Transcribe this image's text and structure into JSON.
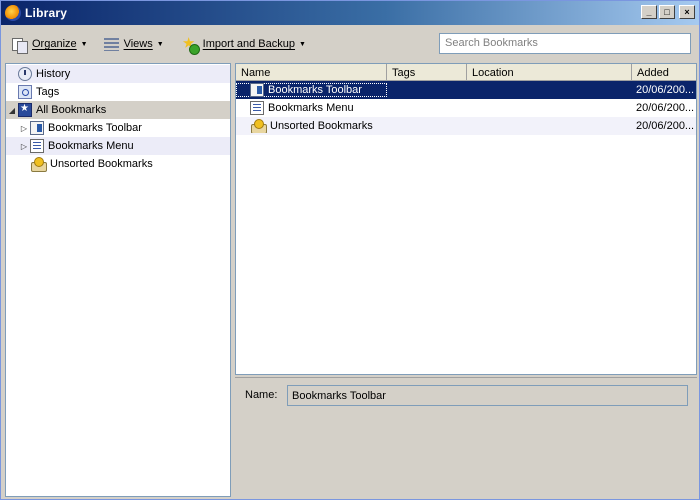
{
  "window": {
    "title": "Library",
    "controls": {
      "minimize": "_",
      "maximize": "□",
      "close": "×"
    }
  },
  "toolbar": {
    "organize_label": "Organize",
    "views_label": "Views",
    "import_label": "Import and Backup",
    "search_placeholder": "Search Bookmarks"
  },
  "sidebar": {
    "items": [
      {
        "label": "History",
        "icon": "history-icon"
      },
      {
        "label": "Tags",
        "icon": "tags-icon"
      },
      {
        "label": "All Bookmarks",
        "icon": "all-bookmarks-icon"
      },
      {
        "label": "Bookmarks Toolbar",
        "icon": "bookmarks-toolbar-icon"
      },
      {
        "label": "Bookmarks Menu",
        "icon": "bookmarks-menu-icon"
      },
      {
        "label": "Unsorted Bookmarks",
        "icon": "unsorted-bookmarks-icon"
      }
    ]
  },
  "table": {
    "columns": [
      "Name",
      "Tags",
      "Location",
      "Added"
    ],
    "rows": [
      {
        "name": "Bookmarks Toolbar",
        "tags": "",
        "location": "",
        "added": "20/06/200..."
      },
      {
        "name": "Bookmarks Menu",
        "tags": "",
        "location": "",
        "added": "20/06/200..."
      },
      {
        "name": "Unsorted Bookmarks",
        "tags": "",
        "location": "",
        "added": "20/06/200..."
      }
    ]
  },
  "details": {
    "name_label": "Name:",
    "name_value": "Bookmarks Toolbar"
  },
  "colors": {
    "selection": "#0a246a",
    "titlebar_start": "#0a246a",
    "titlebar_end": "#a6caf0",
    "chrome": "#d4d0c8"
  }
}
